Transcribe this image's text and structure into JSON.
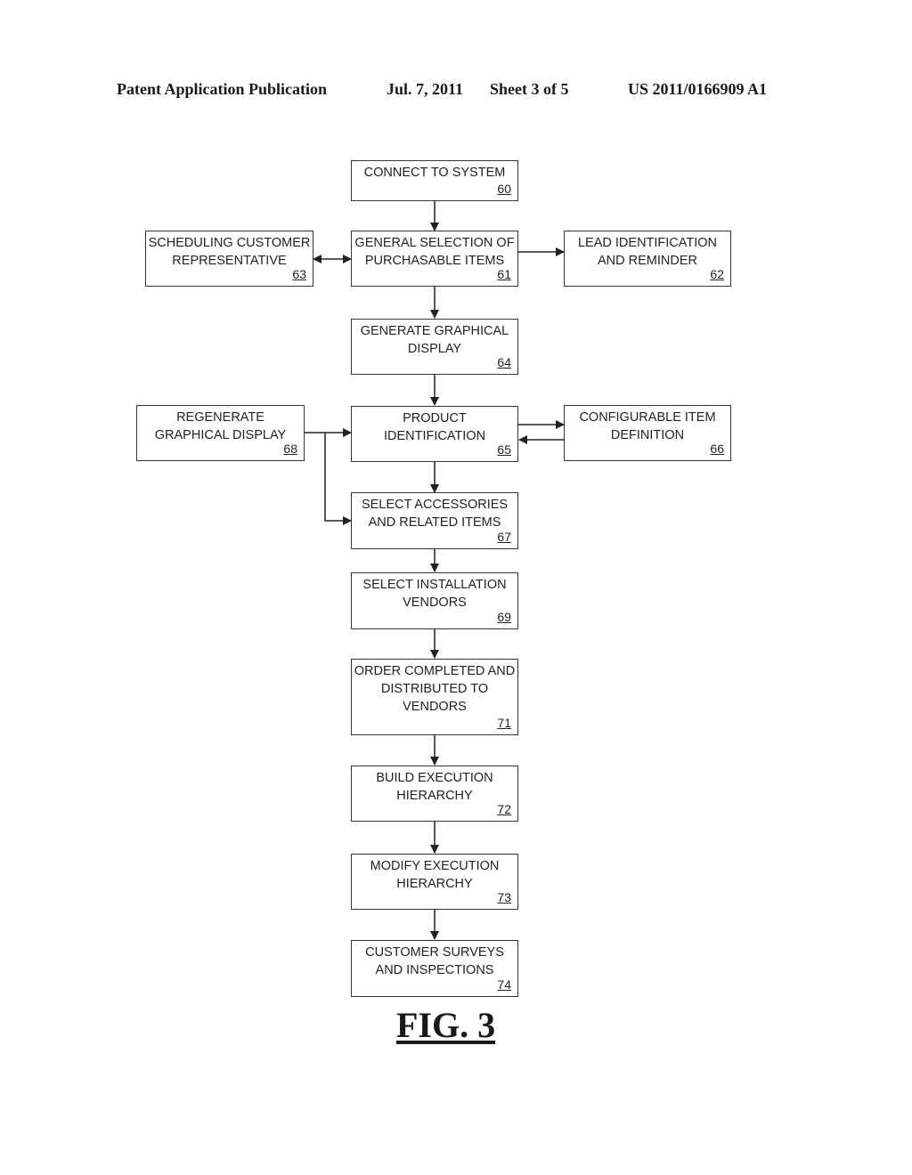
{
  "header": {
    "publication": "Patent Application Publication",
    "date": "Jul. 7, 2011",
    "sheet": "Sheet 3 of 5",
    "number": "US 2011/0166909 A1"
  },
  "boxes": [
    {
      "id": "60",
      "text": "CONNECT TO SYSTEM"
    },
    {
      "id": "61",
      "text": "GENERAL SELECTION OF\nPURCHASABLE ITEMS"
    },
    {
      "id": "62",
      "text": "LEAD IDENTIFICATION\nAND REMINDER"
    },
    {
      "id": "63",
      "text": "SCHEDULING CUSTOMER\nREPRESENTATIVE"
    },
    {
      "id": "64",
      "text": "GENERATE GRAPHICAL\nDISPLAY"
    },
    {
      "id": "65",
      "text": "PRODUCT\nIDENTIFICATION"
    },
    {
      "id": "66",
      "text": "CONFIGURABLE ITEM\nDEFINITION"
    },
    {
      "id": "67",
      "text": "SELECT ACCESSORIES\nAND RELATED ITEMS"
    },
    {
      "id": "68",
      "text": "REGENERATE\nGRAPHICAL DISPLAY"
    },
    {
      "id": "69",
      "text": "SELECT INSTALLATION\nVENDORS"
    },
    {
      "id": "71",
      "text": "ORDER COMPLETED AND\nDISTRIBUTED TO\nVENDORS"
    },
    {
      "id": "72",
      "text": "BUILD EXECUTION\nHIERARCHY"
    },
    {
      "id": "73",
      "text": "MODIFY EXECUTION\nHIERARCHY"
    },
    {
      "id": "74",
      "text": "CUSTOMER SURVEYS\nAND INSPECTIONS"
    }
  ],
  "connections": [
    {
      "from": "60",
      "to": "61",
      "type": "arrow"
    },
    {
      "from": "61",
      "to": "63",
      "type": "bidirectional"
    },
    {
      "from": "61",
      "to": "62",
      "type": "arrow"
    },
    {
      "from": "61",
      "to": "64",
      "type": "arrow"
    },
    {
      "from": "64",
      "to": "65",
      "type": "arrow"
    },
    {
      "from": "65",
      "to": "66",
      "type": "arrow"
    },
    {
      "from": "66",
      "to": "65",
      "type": "arrow"
    },
    {
      "from": "68",
      "to": "65",
      "type": "arrow"
    },
    {
      "from": "68",
      "to": "67",
      "type": "arrow"
    },
    {
      "from": "65",
      "to": "67",
      "type": "arrow"
    },
    {
      "from": "67",
      "to": "69",
      "type": "arrow"
    },
    {
      "from": "69",
      "to": "71",
      "type": "arrow"
    },
    {
      "from": "71",
      "to": "72",
      "type": "arrow"
    },
    {
      "from": "72",
      "to": "73",
      "type": "arrow"
    },
    {
      "from": "73",
      "to": "74",
      "type": "arrow"
    }
  ],
  "figure_label": "FIG. 3"
}
